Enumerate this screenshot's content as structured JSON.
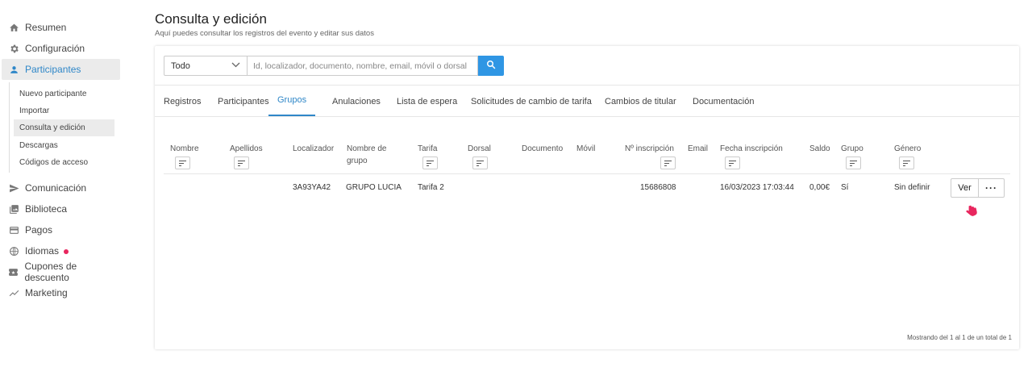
{
  "sidebar": {
    "items": [
      {
        "label": "Resumen",
        "icon": "home-icon"
      },
      {
        "label": "Configuración",
        "icon": "gear-icon"
      },
      {
        "label": "Participantes",
        "icon": "person-icon"
      },
      {
        "label": "Comunicación",
        "icon": "send-icon"
      },
      {
        "label": "Biblioteca",
        "icon": "photo-library-icon"
      },
      {
        "label": "Pagos",
        "icon": "credit-card-icon"
      },
      {
        "label": "Idiomas",
        "icon": "globe-icon"
      },
      {
        "label": "Cupones de descuento",
        "icon": "ticket-icon"
      },
      {
        "label": "Marketing",
        "icon": "trend-line-icon"
      }
    ],
    "sub_items": [
      "Nuevo participante",
      "Importar",
      "Consulta y edición",
      "Descargas",
      "Códigos de acceso"
    ],
    "active_item": "Participantes",
    "active_sub_item": "Consulta y edición"
  },
  "header": {
    "title": "Consulta y edición",
    "subtitle": "Aquí puedes consultar los registros del evento y editar sus datos"
  },
  "search": {
    "filter_value": "Todo",
    "placeholder": "Id, localizador, documento, nombre, email, móvil o dorsal"
  },
  "tabs": [
    "Registros",
    "Participantes",
    "Grupos",
    "Anulaciones",
    "Lista de espera",
    "Solicitudes de cambio de tarifa",
    "Cambios de titular",
    "Documentación"
  ],
  "active_tab": "Grupos",
  "table": {
    "headers": [
      "Nombre",
      "Apellidos",
      "Localizador",
      "Nombre de grupo",
      "Tarifa",
      "Dorsal",
      "Documento",
      "Móvil",
      "Nº inscripción",
      "Email",
      "Fecha inscripción",
      "Saldo",
      "Grupo",
      "Género"
    ],
    "header_lines": {
      "nombre_grupo_1": "Nombre de",
      "nombre_grupo_2": "grupo"
    },
    "rows": [
      {
        "nombre": "",
        "apellidos": "",
        "localizador": "3A93YA42",
        "nombre_grupo": "GRUPO LUCIA",
        "tarifa": "Tarifa 2",
        "dorsal": "",
        "documento": "",
        "movil": "",
        "n_inscripcion": "15686808",
        "email": "",
        "fecha_inscripcion": "16/03/2023 17:03:44",
        "saldo": "0,00€",
        "grupo": "Sí",
        "genero": "Sin definir",
        "view_label": "Ver",
        "more_label": "···"
      }
    ],
    "footer": "Mostrando del 1 al 1 de un total de 1"
  },
  "colors": {
    "accent": "#2f87c8",
    "search_button": "#2f96e4",
    "notification_dot": "#e8265e",
    "cursor": "#e8265e"
  }
}
